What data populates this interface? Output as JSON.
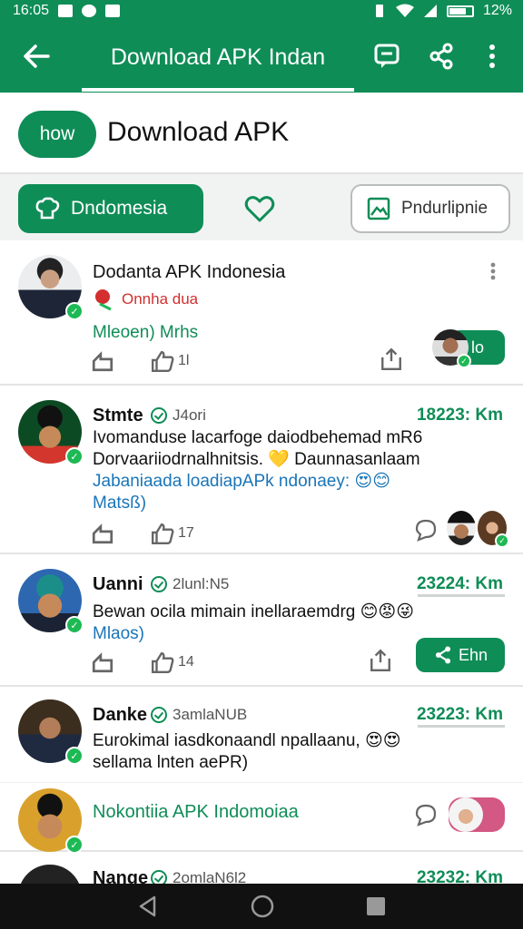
{
  "status_bar": {
    "time": "16:05",
    "battery": "12%"
  },
  "app_bar": {
    "title": "Download APK Indan",
    "back_icon": "arrow-left-icon",
    "actions": [
      "chat-icon",
      "share-icon",
      "more-vert-icon"
    ]
  },
  "hero": {
    "now_label": "how",
    "title": "Download APK"
  },
  "filters": {
    "primary_label": "Dndomesia",
    "primary_icon": "chef-hat-icon",
    "heart_icon": "heart-icon",
    "secondary_label": "Pndurlipnie",
    "secondary_icon": "image-icon"
  },
  "colors": {
    "brand_green": "#0f8d57",
    "link_blue": "#1a75b8",
    "red": "#d32f2f"
  },
  "cards": [
    {
      "name": "Dodanta APK Indonesia",
      "sub": "Onnha dua",
      "tags": "Mleoen) Mrhs",
      "like_count": "1l",
      "follow_label": "lo"
    },
    {
      "name": "Stmte",
      "meta": "J4ori",
      "distance": "18223: Km",
      "text_line1": "Ivomanduse lacarfoge daiodbehemad mR6",
      "text_line2": "Dorvaariiodrnalhnitsis. 💛 Daunnasanlaam",
      "tags": "Jabaniaada loadiapAPk ndonaey: 😍😊",
      "tags_line2": "Matsß)",
      "like_count": "17"
    },
    {
      "name": "Uanni",
      "meta": "2lunl:N5",
      "distance": "23224: Km",
      "text_line1": "Bewan ocila mimain inellaraemdrg 😊😡😜",
      "tags": "Mlaos)",
      "like_count": "14",
      "share_label": "Ehn"
    },
    {
      "name": "Danke",
      "meta": "3amlaNUB",
      "distance": "23223: Km",
      "text_line1": "Eurokimal iasdkonaandl npallaanu, 😍😍",
      "text_line2": "sellama lnten aePR)"
    },
    {
      "name": "Nokontiia APK Indomoiaa"
    },
    {
      "name": "Nange",
      "meta": "2omlaN6l2",
      "distance": "23232: Km"
    }
  ],
  "nav_bar": {
    "items": [
      "back-icon",
      "home-icon",
      "recents-icon"
    ]
  }
}
